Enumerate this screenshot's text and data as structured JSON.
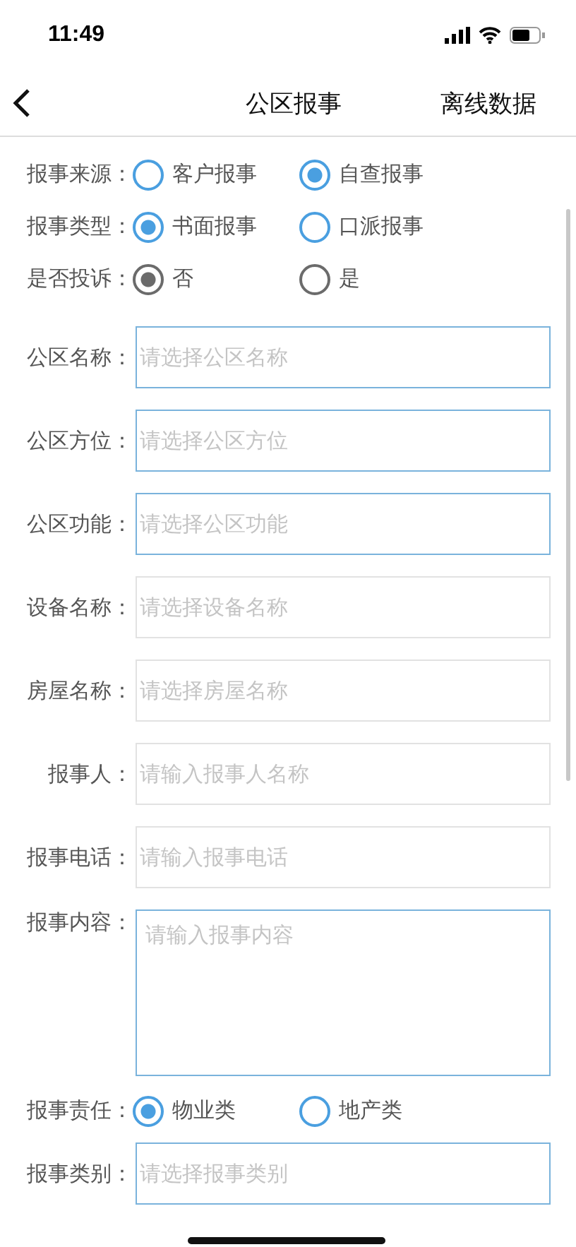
{
  "status_bar": {
    "time": "11:49"
  },
  "nav": {
    "title": "公区报事",
    "action": "离线数据"
  },
  "radio_groups": [
    {
      "label": "报事来源：",
      "kind": "accent",
      "options": [
        {
          "label": "客户报事",
          "selected": false
        },
        {
          "label": "自查报事",
          "selected": true
        }
      ]
    },
    {
      "label": "报事类型：",
      "kind": "accent",
      "options": [
        {
          "label": "书面报事",
          "selected": true
        },
        {
          "label": "口派报事",
          "selected": false
        }
      ]
    },
    {
      "label": "是否投诉：",
      "kind": "plain",
      "options": [
        {
          "label": "否",
          "selected": true
        },
        {
          "label": "是",
          "selected": false
        }
      ]
    }
  ],
  "fields": [
    {
      "label": "公区名称：",
      "placeholder": "请选择公区名称",
      "highlighted": true
    },
    {
      "label": "公区方位：",
      "placeholder": "请选择公区方位",
      "highlighted": true
    },
    {
      "label": "公区功能：",
      "placeholder": "请选择公区功能",
      "highlighted": true
    },
    {
      "label": "设备名称：",
      "placeholder": "请选择设备名称",
      "highlighted": false
    },
    {
      "label": "房屋名称：",
      "placeholder": "请选择房屋名称",
      "highlighted": false
    },
    {
      "label": "报事人：",
      "placeholder": "请输入报事人名称",
      "highlighted": false
    },
    {
      "label": "报事电话：",
      "placeholder": "请输入报事电话",
      "highlighted": false
    }
  ],
  "content": {
    "label": "报事内容：",
    "placeholder": "请输入报事内容"
  },
  "responsibility": {
    "label": "报事责任：",
    "kind": "accent",
    "options": [
      {
        "label": "物业类",
        "selected": true
      },
      {
        "label": "地产类",
        "selected": false
      }
    ]
  },
  "category": {
    "label": "报事类别：",
    "placeholder": "请选择报事类别",
    "highlighted": true
  }
}
